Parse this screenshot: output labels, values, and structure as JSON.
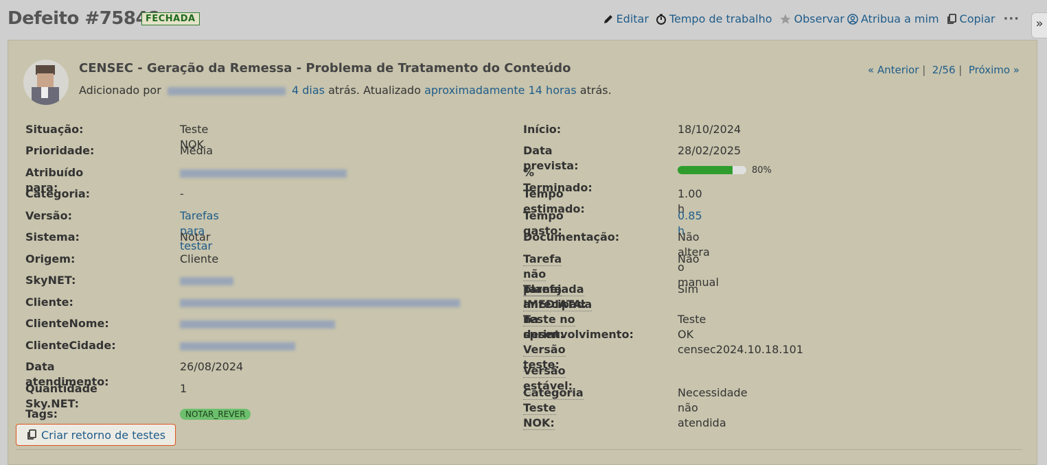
{
  "header": {
    "title": "Defeito #75848",
    "status_badge": "FECHADA",
    "actions": {
      "edit": "Editar",
      "time": "Tempo de trabalho",
      "watch": "Observar",
      "assign": "Atribua a mim",
      "copy": "Copiar"
    },
    "more": "···",
    "sidebar_toggle": "»"
  },
  "issue": {
    "subject": "CENSEC - Geração da Remessa - Problema de Tratamento do Conteúdo",
    "added_prefix": "Adicionado por",
    "added_ago": "4 dias",
    "added_suffix": "atrás. Atualizado",
    "updated_ago": "aproximadamente 14 horas",
    "updated_suffix": "atrás."
  },
  "nav": {
    "prev": "« Anterior",
    "sep": "|",
    "position": "2/56",
    "next": "Próximo »"
  },
  "left_fields": [
    {
      "label": "Situação:",
      "value": "Teste NOK"
    },
    {
      "label": "Prioridade:",
      "value": "Média"
    },
    {
      "label": "Atribuído para:",
      "value": ""
    },
    {
      "label": "Categoria:",
      "value": "-"
    },
    {
      "label": "Versão:",
      "value": "Tarefas para testar"
    },
    {
      "label": "Sistema:",
      "value": "Notar"
    },
    {
      "label": "Origem:",
      "value": "Cliente"
    },
    {
      "label": "SkyNET:",
      "value": ""
    },
    {
      "label": "Cliente:",
      "value": ""
    },
    {
      "label": "ClienteNome:",
      "value": ""
    },
    {
      "label": "ClienteCidade:",
      "value": ""
    },
    {
      "label": "Data atendimento:",
      "value": "26/08/2024"
    },
    {
      "label": "Quantidade Sky.NET:",
      "value": "1"
    },
    {
      "label": "Tags:",
      "value": "NOTAR_REVER"
    }
  ],
  "right_fields": [
    {
      "label": "Início:",
      "value": "18/10/2024"
    },
    {
      "label": "Data prevista:",
      "value": "28/02/2025"
    },
    {
      "label": "% Terminado:",
      "value": "80%",
      "progress": 0.8
    },
    {
      "label": "Tempo estimado:",
      "value": "1.00 h"
    },
    {
      "label": "Tempo gasto:",
      "value": "0.85 h"
    },
    {
      "label": "Documentação:",
      "value": "Não altera o manual"
    },
    {
      "label_line1": "Tarefa não planejada",
      "label_line2": "IMEDIATA:",
      "value": "Não"
    },
    {
      "label_line1": "Tarefa antecipada na",
      "label_line2": "sprint:",
      "value": "Sim"
    },
    {
      "label_line1": "Teste no",
      "label_line2": "desenvolvimento:",
      "value": "Teste OK"
    },
    {
      "label": "Versão teste:",
      "value": "censec2024.10.18.101"
    },
    {
      "label": "Versão estável:",
      "value": ""
    },
    {
      "label": "Categoria Teste NOK:",
      "value": "Necessidade não atendida"
    }
  ],
  "create_return_button": "Criar retorno de testes",
  "colors": {
    "link": "#1f5c8a",
    "panel": "#c8c4ad",
    "progress": "#2e9d2e",
    "tag": "#6cbf6c",
    "button_border": "#e0531f"
  }
}
